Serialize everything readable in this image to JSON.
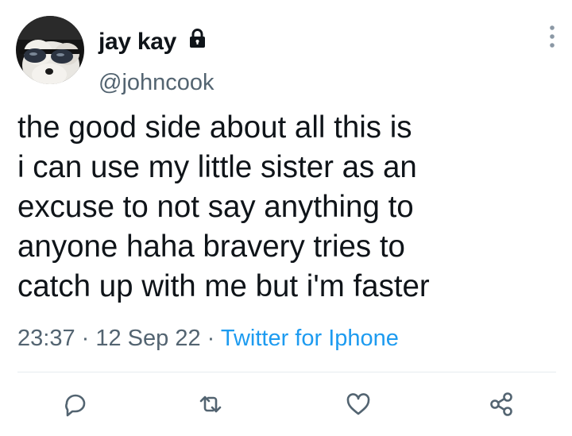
{
  "user": {
    "display_name": "jay kay",
    "handle": "@johncook",
    "protected": true,
    "avatar": "dog-with-sunglasses"
  },
  "tweet": {
    "lines": [
      "the good side about all this is",
      "i can use my little sister as an",
      "excuse to not say anything to",
      "anyone haha bravery tries to",
      "catch up with me but i'm faster"
    ],
    "time": "23:37",
    "date": "12 Sep 22",
    "source": "Twitter for Iphone",
    "separator": " · "
  },
  "actions": [
    "reply-icon",
    "retweet-icon",
    "like-icon",
    "share-icon"
  ],
  "icons": {
    "more": "more-vertical-icon",
    "lock": "lock-icon"
  },
  "colors": {
    "text": "#0f1419",
    "secondary": "#536471",
    "accent": "#1d9bf0",
    "divider": "#e6ecf0"
  }
}
